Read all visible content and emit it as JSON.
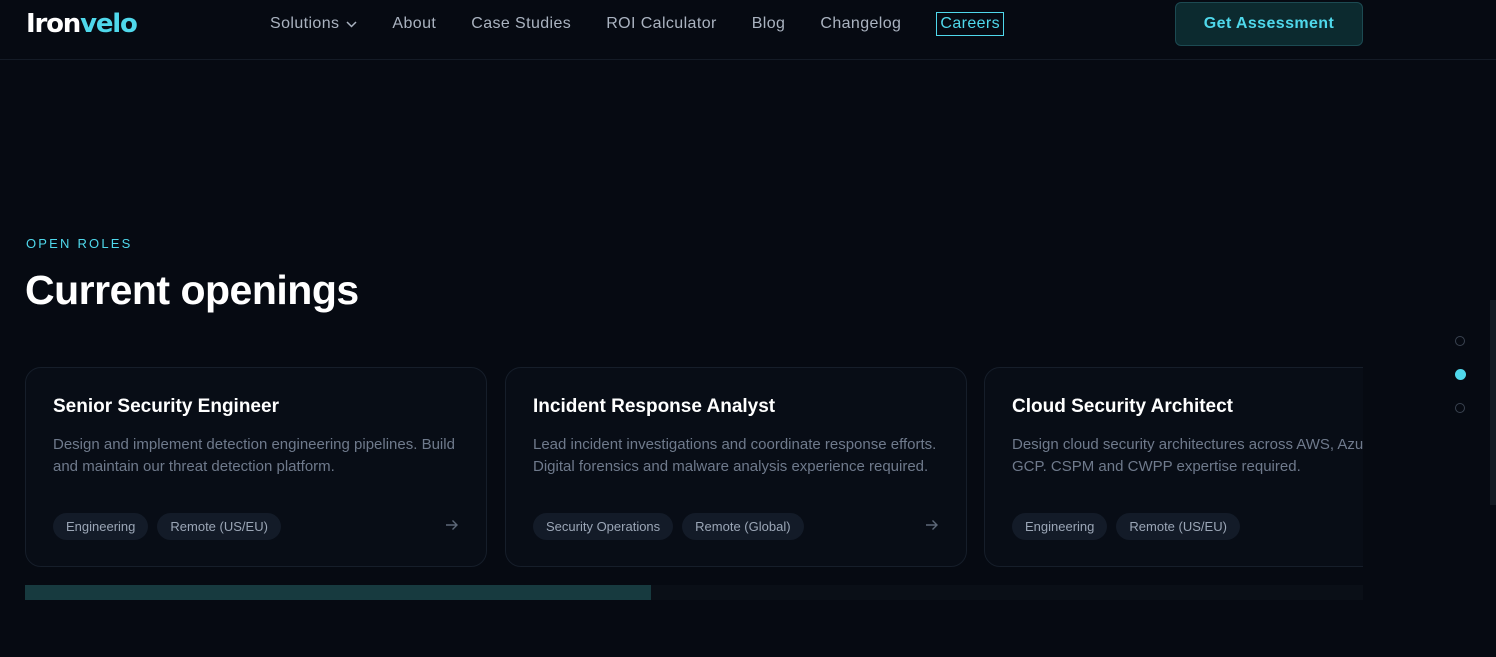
{
  "nav": {
    "logo_main": "Iron",
    "logo_accent": "velo",
    "links": [
      {
        "label": "Solutions"
      },
      {
        "label": "About"
      },
      {
        "label": "Case Studies"
      },
      {
        "label": "ROI Calculator"
      },
      {
        "label": "Blog"
      },
      {
        "label": "Changelog"
      },
      {
        "label": "Careers"
      }
    ],
    "active_link": "Careers",
    "cta_label": "Get Assessment"
  },
  "section": {
    "eyebrow": "OPEN ROLES",
    "heading": "Current openings"
  },
  "jobs": [
    {
      "title": "Senior Security Engineer",
      "description": "Design and implement detection engineering pipelines. Build and maintain our threat detection platform.",
      "tags": [
        "Engineering",
        "Remote (US/EU)"
      ]
    },
    {
      "title": "Incident Response Analyst",
      "description": "Lead incident investigations and coordinate response efforts. Digital forensics and malware analysis experience required.",
      "tags": [
        "Security Operations",
        "Remote (Global)"
      ]
    },
    {
      "title": "Cloud Security Architect",
      "description": "Design cloud security architectures across AWS, Azure, and GCP. CSPM and CWPP expertise required.",
      "tags": [
        "Engineering",
        "Remote (US/EU)"
      ]
    }
  ],
  "carousel": {
    "progress_fraction": 0.468,
    "dot_count": 3,
    "active_dot": 1
  },
  "colors": {
    "accent": "#4fd8eb",
    "background": "#060a12",
    "card_background": "#080d16"
  },
  "icons": {
    "dropdown": "chevron-down-icon",
    "card_link": "arrow-right-icon"
  }
}
